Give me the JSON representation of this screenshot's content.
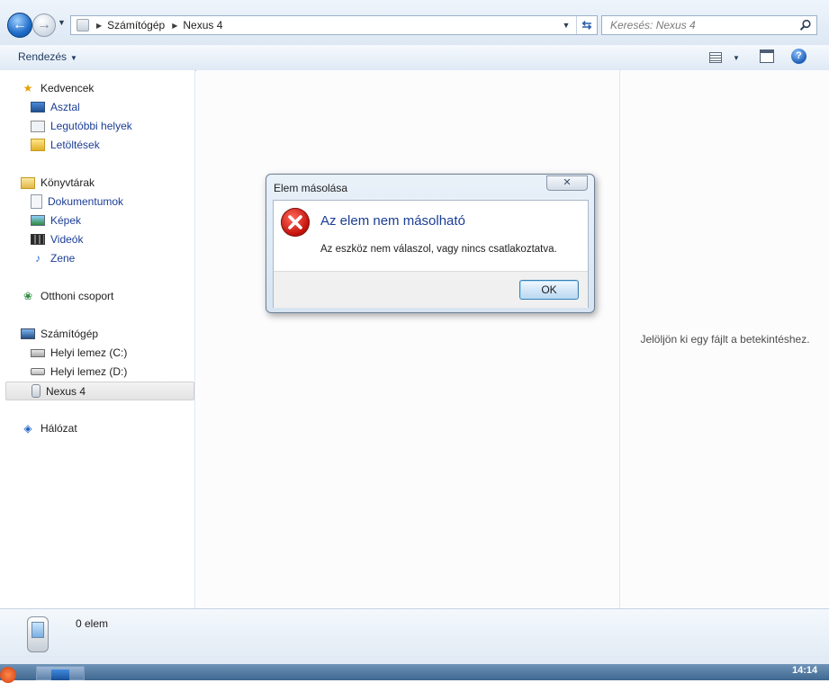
{
  "address_bar": {
    "crumbs": [
      "Számítógép",
      "Nexus 4"
    ],
    "search_placeholder": "Keresés: Nexus 4"
  },
  "toolbar": {
    "organize_label": "Rendezés",
    "help_label": "?"
  },
  "nav": {
    "favorites": {
      "label": "Kedvencek",
      "items": [
        {
          "label": "Asztal",
          "icon": "desktop-icon"
        },
        {
          "label": "Legutóbbi helyek",
          "icon": "recent-places-icon"
        },
        {
          "label": "Letöltések",
          "icon": "downloads-folder-icon"
        }
      ]
    },
    "libraries": {
      "label": "Könyvtárak",
      "items": [
        {
          "label": "Dokumentumok",
          "icon": "documents-icon"
        },
        {
          "label": "Képek",
          "icon": "pictures-icon"
        },
        {
          "label": "Videók",
          "icon": "videos-icon"
        },
        {
          "label": "Zene",
          "icon": "music-note-icon"
        }
      ]
    },
    "homegroup": {
      "label": "Otthoni csoport"
    },
    "computer": {
      "label": "Számítógép",
      "items": [
        {
          "label": "Helyi lemez (C:)",
          "icon": "windows-drive-icon"
        },
        {
          "label": "Helyi lemez (D:)",
          "icon": "drive-icon"
        },
        {
          "label": "Nexus 4",
          "icon": "phone-icon",
          "selected": true
        }
      ]
    },
    "network": {
      "label": "Hálózat"
    }
  },
  "preview": {
    "message": "Jelöljön ki egy fájlt a betekintéshez."
  },
  "status": {
    "text": "0 elem"
  },
  "taskbar": {
    "clock": "14:14"
  },
  "dialog": {
    "title": "Elem másolása",
    "close_glyph": "✕",
    "heading": "Az elem nem másolható",
    "message": "Az eszköz nem válaszol, vagy nincs csatlakoztatva.",
    "ok_label": "OK"
  },
  "colors": {
    "link_blue": "#1a3d95",
    "error_red": "#c4120c",
    "chrome_blue": "#dde8f4"
  }
}
